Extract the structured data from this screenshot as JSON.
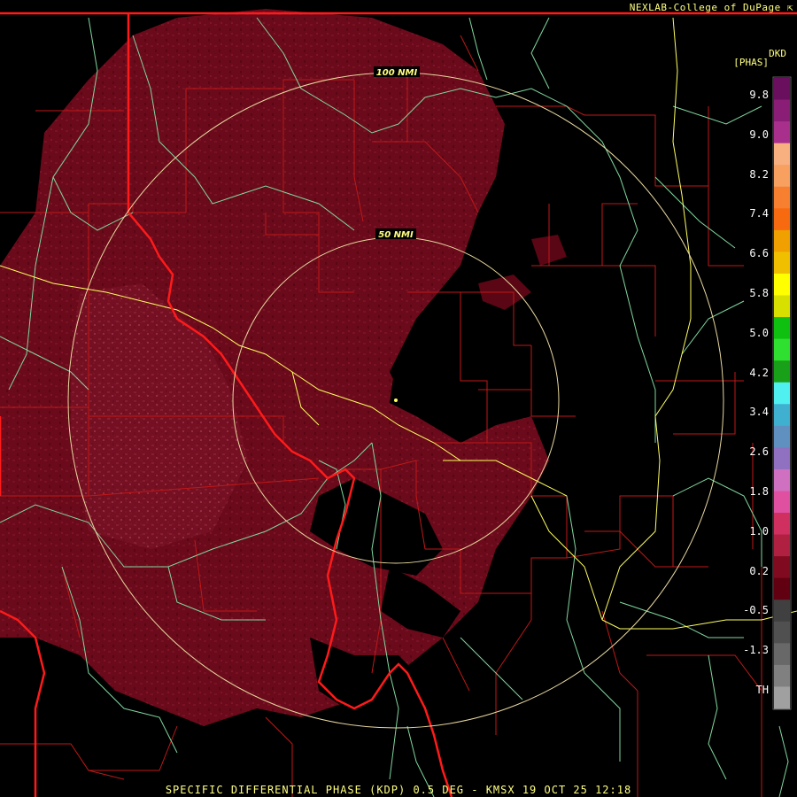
{
  "credit": "NEXLAB-College of DuPage",
  "caption": "SPECIFIC DIFFERENTIAL PHASE (KDP) 0.5 DEG - KMSX 19 OCT 25 12:18",
  "legend": {
    "title_line1": "DKD",
    "title_line2": "[PHAS]",
    "labels": [
      "9.8",
      "9.0",
      "8.2",
      "7.4",
      "6.6",
      "5.8",
      "5.0",
      "4.2",
      "3.4",
      "2.6",
      "1.8",
      "1.0",
      "0.2",
      "-0.5",
      "-1.3",
      "TH"
    ],
    "colors": [
      "#6a0f5e",
      "#8a1d76",
      "#a8308c",
      "#f8b080",
      "#f7a060",
      "#f78030",
      "#f76a10",
      "#f0a000",
      "#f0c000",
      "#ffff00",
      "#d8e000",
      "#10c010",
      "#30e030",
      "#18a018",
      "#50f0f0",
      "#40b0d0",
      "#6090c0",
      "#9070c0",
      "#d070c0",
      "#e050a0",
      "#d03060",
      "#b02040",
      "#800a20",
      "#600010",
      "#404040",
      "#505050",
      "#686868",
      "#808080",
      "#a0a0a0"
    ]
  },
  "rings": {
    "inner_label": "50 NMI",
    "outer_label": "100 NMI"
  },
  "colors": {
    "echo": "#6e0a1c",
    "echo_light": "#8a1830",
    "state_border": "#ff1a1a",
    "county_border": "#c01818",
    "highway": "#ffff60",
    "river": "#80d8a0",
    "ring": "#e8d8a0"
  },
  "icons": {
    "credit_arrow": "arrow-icon"
  }
}
